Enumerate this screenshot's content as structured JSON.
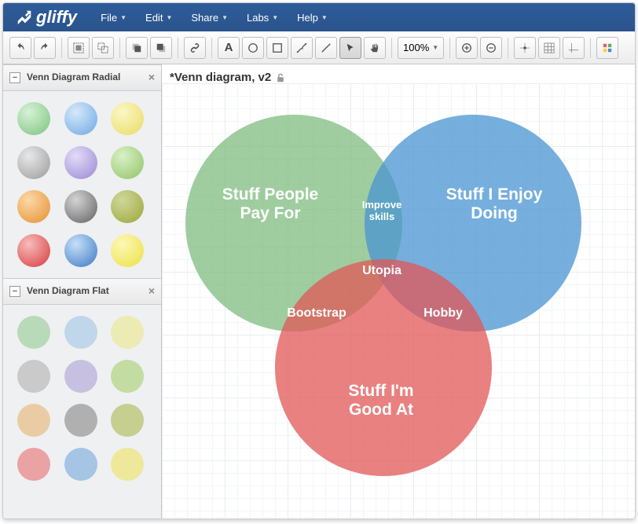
{
  "brand": "gliffy",
  "menus": [
    "File",
    "Edit",
    "Share",
    "Labs",
    "Help"
  ],
  "toolbar": {
    "zoom": "100%"
  },
  "sidebar": {
    "panel1_title": "Venn Diagram Radial",
    "panel2_title": "Venn Diagram Flat"
  },
  "document": {
    "title": "*Venn diagram, v2"
  },
  "circles": {
    "c1": {
      "color": "rgba(122,186,122,0.72)",
      "label": "Stuff People\nPay For"
    },
    "c2": {
      "color": "rgba(72,148,210,0.75)",
      "label": "Stuff I Enjoy\nDoing"
    },
    "c3": {
      "color": "rgba(226,87,87,0.75)",
      "label": "Stuff I'm\nGood At"
    }
  },
  "intersections": {
    "ab": "Improve\nskills",
    "abc": "Utopia",
    "ac": "Bootstrap",
    "bc": "Hobby"
  },
  "swatches_radial": [
    "radial-gradient(circle at 35% 30%, #d6f2d6, #7cc27c)",
    "radial-gradient(circle at 35% 30%, #d6e8fa, #6ca8e4)",
    "radial-gradient(circle at 35% 30%, #fcf7c6, #e8dc60)",
    "radial-gradient(circle at 35% 30%, #e8e8e8, #9a9a9a)",
    "radial-gradient(circle at 35% 30%, #e2dcf6, #9a86d6)",
    "radial-gradient(circle at 35% 30%, #daf0c8, #8ec464)",
    "radial-gradient(circle at 35% 30%, #fcd8a8, #e49030)",
    "radial-gradient(circle at 35% 30%, #d4d4d4, #606060)",
    "radial-gradient(circle at 35% 30%, #d0d89a, #9aa63a)",
    "radial-gradient(circle at 35% 30%, #f8bcbc, #d63a3a)",
    "radial-gradient(circle at 35% 30%, #c6e0f8, #3a78c4)",
    "radial-gradient(circle at 35% 30%, #fcf8b8, #ece040)"
  ],
  "swatches_flat": [
    "#b8dab8",
    "#c0d6ea",
    "#ecebb4",
    "#cacaca",
    "#c8c0e0",
    "#c2dca2",
    "#eacca4",
    "#b0b0b0",
    "#c6ce90",
    "#eaa2a2",
    "#a6c4e4",
    "#eee89a"
  ]
}
